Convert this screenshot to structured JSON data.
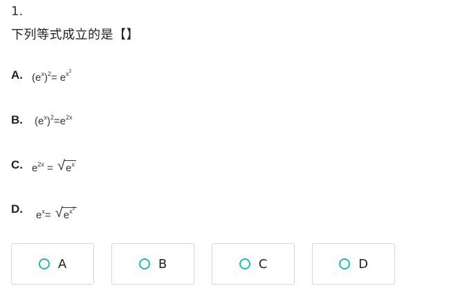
{
  "question": {
    "number": "1.",
    "stem": "下列等式成立的是【】"
  },
  "options": [
    {
      "letter": "A.",
      "math": "(e^x)^2 = e^(x^2)"
    },
    {
      "letter": "B.",
      "math": "(e^x)^2 = e^(2x)"
    },
    {
      "letter": "C.",
      "math": "e^(2x) = √(e^x)"
    },
    {
      "letter": "D.",
      "math": "e^x = √(e^(x^2))"
    }
  ],
  "choices": [
    {
      "label": "A"
    },
    {
      "label": "B"
    },
    {
      "label": "C"
    },
    {
      "label": "D"
    }
  ],
  "colors": {
    "radio_border": "#20b8b0",
    "card_border": "#d6d6d6"
  }
}
